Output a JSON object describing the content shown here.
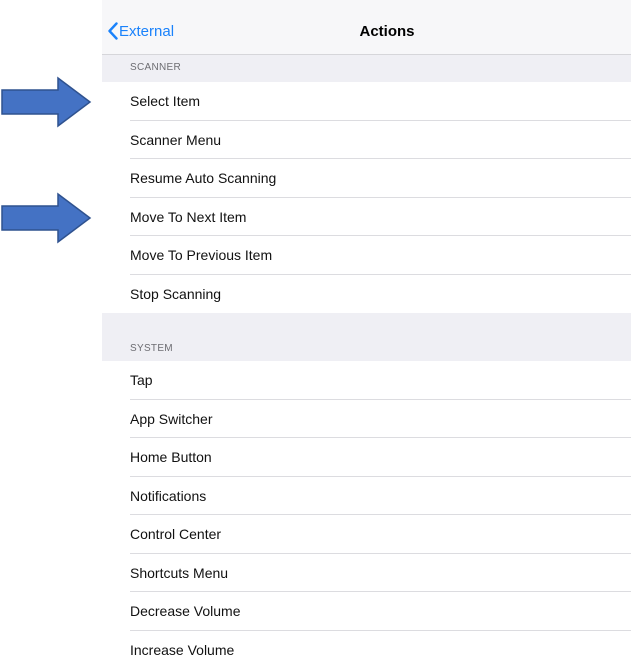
{
  "navbar": {
    "back_label": "External",
    "title": "Actions"
  },
  "sections": {
    "scanner": {
      "header": "SCANNER",
      "items": [
        "Select Item",
        "Scanner Menu",
        "Resume Auto Scanning",
        "Move To Next Item",
        "Move To Previous Item",
        "Stop Scanning"
      ]
    },
    "system": {
      "header": "SYSTEM",
      "items": [
        "Tap",
        "App Switcher",
        "Home Button",
        "Notifications",
        "Control Center",
        "Shortcuts Menu",
        "Decrease Volume",
        "Increase Volume"
      ]
    }
  },
  "annotations": {
    "arrow_color": "#4472c4",
    "arrow_stroke": "#2f528f",
    "icons": [
      "right-arrow-icon",
      "chevron-left-icon"
    ]
  },
  "colors": {
    "accent": "#1a82fb",
    "background": "#efeff4"
  }
}
